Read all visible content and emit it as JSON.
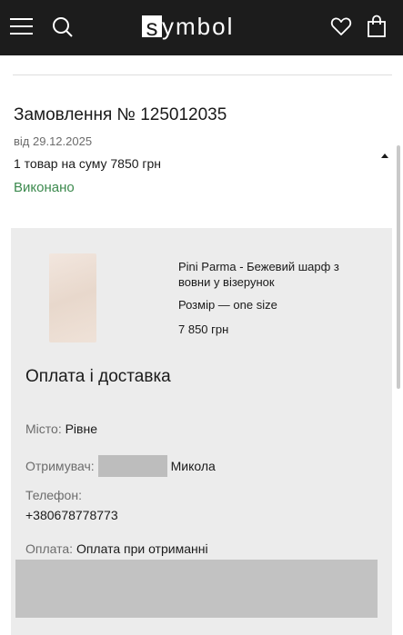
{
  "header": {
    "logo_letter": "s",
    "logo_rest": "ymbol",
    "icons": [
      "menu-icon",
      "search-icon",
      "heart-icon",
      "bag-icon"
    ],
    "background": "#1c1c1c"
  },
  "order": {
    "title": "Замовлення № 125012035",
    "date": "від 29.12.2025",
    "summary": "1 товар на суму 7850 грн",
    "status": "Виконано",
    "status_color": "#3c8a4e"
  },
  "product": {
    "name": "Pini Parma - Бежевий шарф з вовни у візерунок",
    "size": "Розмір — one size",
    "price": "7 850 грн"
  },
  "delivery": {
    "title": "Оплата і доставка",
    "city_label": "Місто:",
    "city_value": "Рівне",
    "recipient_label": "Отримувач:",
    "recipient_value": "Микола",
    "phone_label": "Телефон:",
    "phone_value": "+380678778773",
    "payment_label": "Оплата:",
    "payment_value": "Оплата при отриманні"
  }
}
